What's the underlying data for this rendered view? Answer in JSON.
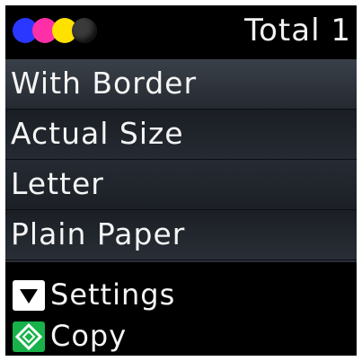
{
  "status": {
    "ink_icon": "ink-level-icon",
    "ink_colors": [
      "#2a38ff",
      "#ff2fa8",
      "#ffe100",
      "#2a2a2a"
    ],
    "total_label": "Total 1"
  },
  "menu": {
    "items": [
      {
        "label": "With Border"
      },
      {
        "label": "Actual Size"
      },
      {
        "label": "Letter"
      },
      {
        "label": "Plain Paper"
      }
    ]
  },
  "actions": {
    "settings": {
      "icon": "down-triangle-icon",
      "label": "Settings"
    },
    "copy": {
      "icon": "start-diamond-icon",
      "label": "Copy",
      "accent": "#18b24a"
    }
  }
}
